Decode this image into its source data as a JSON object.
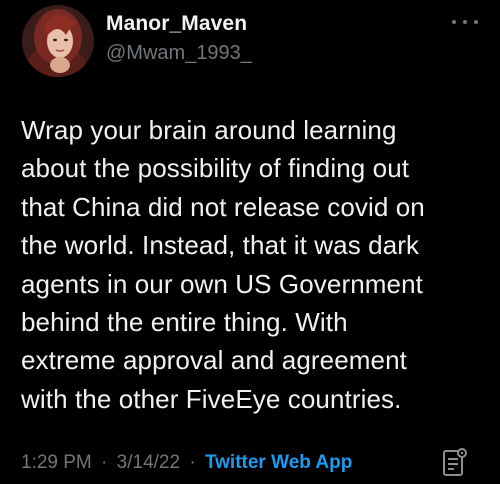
{
  "author": {
    "display_name": "Manor_Maven",
    "handle": "@Mwam_1993_",
    "avatar_icon": "profile-photo"
  },
  "tweet": {
    "text_lines": [
      "Wrap your brain around learning",
      "about the possibility of finding out",
      "that China did not release covid on",
      "the world. Instead, that it was dark",
      "agents in our own US Government",
      "behind the entire thing. With",
      "extreme approval and agreement",
      "with the other FiveEye  countries."
    ]
  },
  "meta": {
    "time": "1:29 PM",
    "separator": "·",
    "date": "3/14/22",
    "source": "Twitter Web App"
  },
  "icons": {
    "more": "more-options-icon",
    "analytics": "analytics-icon"
  },
  "colors": {
    "background": "#000000",
    "text": "#e7e9ea",
    "secondary": "#71767b",
    "accent": "#1d9bf0"
  }
}
